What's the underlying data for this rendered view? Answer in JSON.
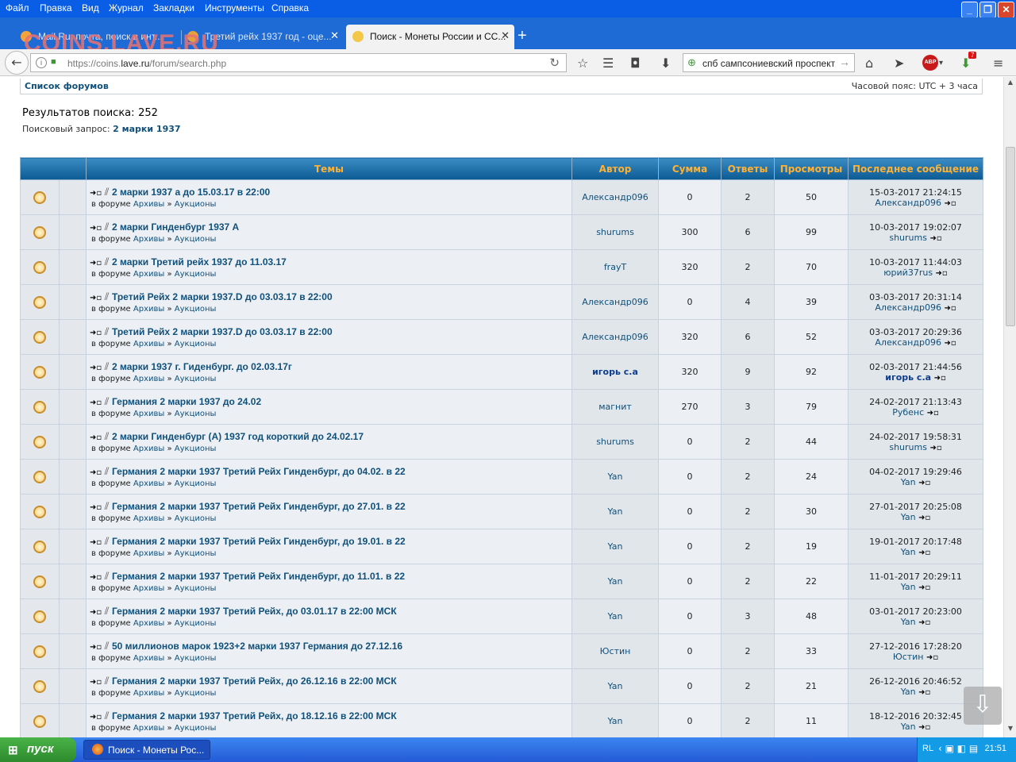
{
  "browser": {
    "menu": [
      "Файл",
      "Правка",
      "Вид",
      "Журнал",
      "Закладки",
      "Инструменты",
      "Справка"
    ],
    "watermark": "COINS.LAVE.RU",
    "tabs": [
      {
        "label": "Mail.Ru: почта, поиск в инт...",
        "active": false
      },
      {
        "label": "Третий рейх 1937 год - оце...",
        "active": false
      },
      {
        "label": "Поиск - Монеты России и СС...",
        "active": true
      }
    ],
    "url_prefix": "https://coins.",
    "url_domain": "lave.ru",
    "url_path": "/forum/search.php",
    "search_value": "спб сампсониевский проспект",
    "abp_label": "ABP",
    "download_badge": "7"
  },
  "page": {
    "forums_link": "Список форумов",
    "timezone": "Часовой пояс: UTC + 3 часа",
    "results_label": "Результатов поиска:",
    "results_count": "252",
    "query_label": "Поисковый запрос:",
    "query_value": "2 марки 1937"
  },
  "table": {
    "headers": [
      "Темы",
      "Автор",
      "Сумма",
      "Ответы",
      "Просмотры",
      "Последнее сообщение"
    ],
    "forum_prefix": "в форуме",
    "forum_archive": "Архивы",
    "forum_sep": "»",
    "forum_auctions": "Аукционы",
    "rows": [
      {
        "title": "2 марки 1937 а до 15.03.17 в 22:00",
        "author": "Александр096",
        "sum": "0",
        "replies": "2",
        "views": "50",
        "last_date": "15-03-2017 21:24:15",
        "last_user": "Александр096"
      },
      {
        "title": "2 марки Гинденбург 1937 А",
        "author": "shurums",
        "sum": "300",
        "replies": "6",
        "views": "99",
        "last_date": "10-03-2017 19:02:07",
        "last_user": "shurums"
      },
      {
        "title": "2 марки Третий рейх 1937 до 11.03.17",
        "author": "frayT",
        "sum": "320",
        "replies": "2",
        "views": "70",
        "last_date": "10-03-2017 11:44:03",
        "last_user": "юрий37rus"
      },
      {
        "title": "Третий Рейх 2 марки 1937.D до 03.03.17 в 22:00",
        "author": "Александр096",
        "sum": "0",
        "replies": "4",
        "views": "39",
        "last_date": "03-03-2017 20:31:14",
        "last_user": "Александр096"
      },
      {
        "title": "Третий Рейх 2 марки 1937.D до 03.03.17 в 22:00",
        "author": "Александр096",
        "sum": "320",
        "replies": "6",
        "views": "52",
        "last_date": "03-03-2017 20:29:36",
        "last_user": "Александр096"
      },
      {
        "title": "2 марки 1937 г. Гиденбург. до 02.03.17г",
        "author": "игорь с.а",
        "sum": "320",
        "replies": "9",
        "views": "92",
        "last_date": "02-03-2017 21:44:56",
        "last_user": "игорь с.а"
      },
      {
        "title": "Германия 2 марки 1937 до 24.02",
        "author": "магнит",
        "sum": "270",
        "replies": "3",
        "views": "79",
        "last_date": "24-02-2017 21:13:43",
        "last_user": "Рубенс"
      },
      {
        "title": "2 марки Гинденбург (А) 1937 год короткий до 24.02.17",
        "author": "shurums",
        "sum": "0",
        "replies": "2",
        "views": "44",
        "last_date": "24-02-2017 19:58:31",
        "last_user": "shurums"
      },
      {
        "title": "Германия 2 марки 1937 Третий Рейх Гинденбург, до 04.02. в 22",
        "author": "Yan",
        "sum": "0",
        "replies": "2",
        "views": "24",
        "last_date": "04-02-2017 19:29:46",
        "last_user": "Yan"
      },
      {
        "title": "Германия 2 марки 1937 Третий Рейх Гинденбург, до 27.01. в 22",
        "author": "Yan",
        "sum": "0",
        "replies": "2",
        "views": "30",
        "last_date": "27-01-2017 20:25:08",
        "last_user": "Yan"
      },
      {
        "title": "Германия 2 марки 1937 Третий Рейх Гинденбург, до 19.01. в 22",
        "author": "Yan",
        "sum": "0",
        "replies": "2",
        "views": "19",
        "last_date": "19-01-2017 20:17:48",
        "last_user": "Yan"
      },
      {
        "title": "Германия 2 марки 1937 Третий Рейх Гинденбург, до 11.01. в 22",
        "author": "Yan",
        "sum": "0",
        "replies": "2",
        "views": "22",
        "last_date": "11-01-2017 20:29:11",
        "last_user": "Yan"
      },
      {
        "title": "Германия 2 марки 1937 Третий Рейх, до 03.01.17 в 22:00 МСК",
        "author": "Yan",
        "sum": "0",
        "replies": "3",
        "views": "48",
        "last_date": "03-01-2017 20:23:00",
        "last_user": "Yan"
      },
      {
        "title": "50 миллионов марок 1923+2 марки 1937 Германия до 27.12.16",
        "author": "Юстин",
        "sum": "0",
        "replies": "2",
        "views": "33",
        "last_date": "27-12-2016 17:28:20",
        "last_user": "Юстин"
      },
      {
        "title": "Германия 2 марки 1937 Третий Рейх, до 26.12.16 в 22:00 МСК",
        "author": "Yan",
        "sum": "0",
        "replies": "2",
        "views": "21",
        "last_date": "26-12-2016 20:46:52",
        "last_user": "Yan"
      },
      {
        "title": "Германия 2 марки 1937 Третий Рейх, до 18.12.16 в 22:00 МСК",
        "author": "Yan",
        "sum": "0",
        "replies": "2",
        "views": "11",
        "last_date": "18-12-2016 20:32:45",
        "last_user": "Yan"
      }
    ]
  },
  "taskbar": {
    "start_label": "пуск",
    "task_label": "Поиск - Монеты Рос...",
    "lang": "RL",
    "clock": "21:51"
  },
  "colors": {
    "header_gradient_top": "#3b8cc4",
    "header_gradient_bottom": "#0c5a93",
    "header_text": "#ffb133",
    "link": "#10507a"
  }
}
